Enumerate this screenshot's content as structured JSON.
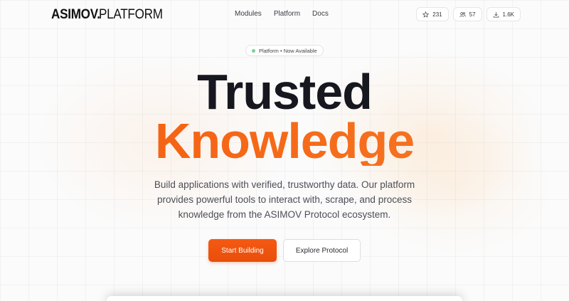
{
  "header": {
    "logo_bold": "ASIMOV.",
    "logo_light": "PLATFORM",
    "nav": [
      "Modules",
      "Platform",
      "Docs"
    ],
    "stats": [
      {
        "icon": "star-icon",
        "value": "231"
      },
      {
        "icon": "users-icon",
        "value": "57"
      },
      {
        "icon": "download-icon",
        "value": "1.6K"
      }
    ]
  },
  "hero": {
    "badge": "Platform • Now Available",
    "title_line1": "Trusted",
    "title_line2": "Knowledge",
    "subtitle": "Build applications with verified, trustworthy data. Our platform provides powerful tools to interact with, scrape, and process knowledge from the ASIMOV Protocol ecosystem.",
    "primary_button": "Start Building",
    "secondary_button": "Explore Protocol"
  },
  "colors": {
    "accent": "#f45a12",
    "text_dark": "#16171f",
    "status_dot": "#7ad19a"
  }
}
